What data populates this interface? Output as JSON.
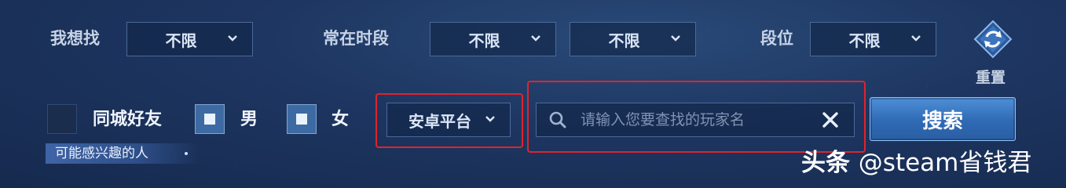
{
  "filters": {
    "looking_for": {
      "label": "我想找",
      "value": "不限"
    },
    "active_time": {
      "label": "常在时段",
      "value_start": "不限",
      "value_end": "不限"
    },
    "rank": {
      "label": "段位",
      "value": "不限"
    },
    "reset": {
      "label": "重置",
      "icon": "refresh-icon"
    }
  },
  "options": {
    "same_city": {
      "label": "同城好友",
      "checked": false
    },
    "male": {
      "label": "男",
      "checked": true
    },
    "female": {
      "label": "女",
      "checked": true
    }
  },
  "banner": {
    "label": "可能感兴趣的人"
  },
  "platform": {
    "value": "安卓平台"
  },
  "search": {
    "placeholder": "请输入您要查找的玩家名",
    "value": "",
    "button_label": "搜索"
  },
  "watermark": {
    "source": "头条",
    "handle": "@steam省钱君"
  },
  "colors": {
    "highlight": "#e0242a",
    "accent": "#3f7fc9",
    "background": "#1d3560"
  }
}
